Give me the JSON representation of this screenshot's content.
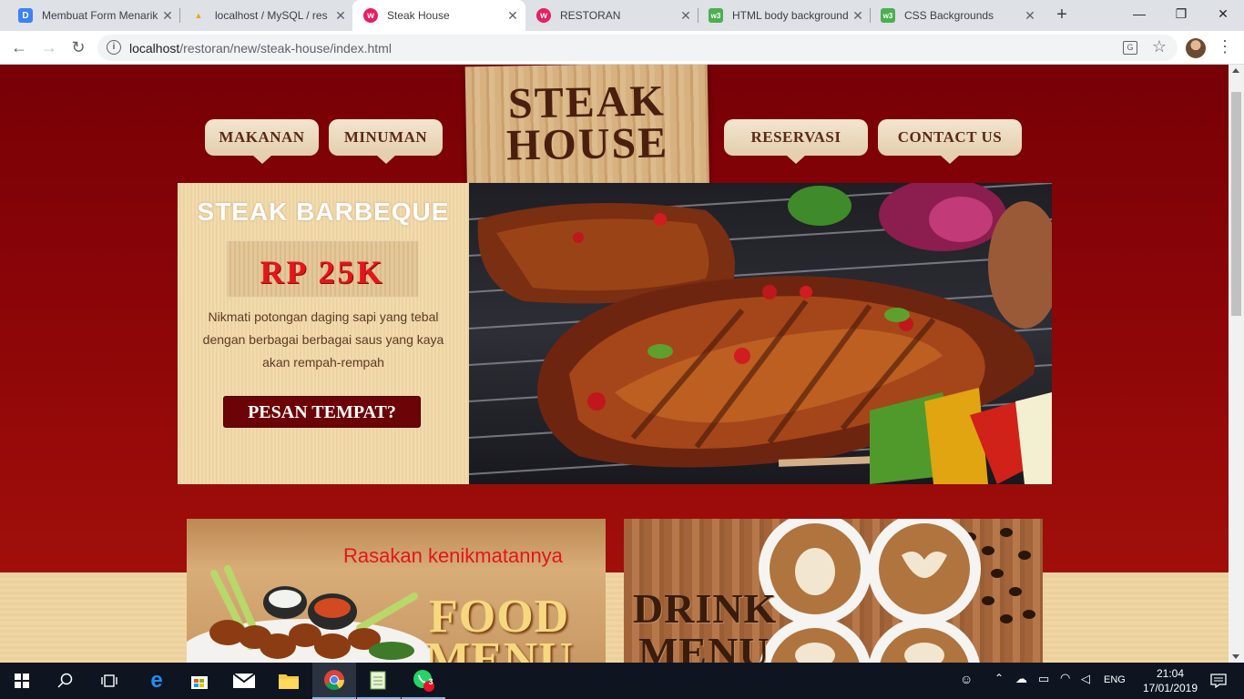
{
  "browser": {
    "tabs": [
      {
        "title": "Membuat Form Menarik",
        "favicon": "D",
        "fav_color": "#3b82f6"
      },
      {
        "title": "localhost / MySQL / res",
        "favicon": "pma",
        "fav_color": "#f0a500"
      },
      {
        "title": "Steak House",
        "favicon": "w",
        "fav_color": "#e91e63"
      },
      {
        "title": "RESTORAN",
        "favicon": "w",
        "fav_color": "#e91e63"
      },
      {
        "title": "HTML body background",
        "favicon": "w3",
        "fav_color": "#4caf50"
      },
      {
        "title": "CSS Backgrounds",
        "favicon": "w3",
        "fav_color": "#4caf50"
      }
    ],
    "url_host": "localhost",
    "url_path": "/restoran/new/steak-house/index.html"
  },
  "site": {
    "nav": {
      "left": [
        "MAKANAN",
        "MINUMAN"
      ],
      "right": [
        "RESERVASI",
        "CONTACT US"
      ]
    },
    "logo": {
      "line1": "STEAK",
      "line2": "HOUSE"
    },
    "hero": {
      "title": "STEAK BARBEQUE",
      "price": "RP 25K",
      "description": "Nikmati potongan daging sapi yang tebal dengan berbagai berbagai saus yang kaya akan rempah-rempah",
      "cta": "PESAN TEMPAT?"
    },
    "cards": {
      "food": {
        "tagline": "Rasakan kenikmatannya",
        "line1": "FOOD",
        "line2": "MENU"
      },
      "drink": {
        "line1": "DRINK",
        "line2": "MENU"
      }
    }
  },
  "taskbar": {
    "lang": "ENG",
    "time": "21:04",
    "date": "17/01/2019",
    "whatsapp_badge": "3"
  }
}
